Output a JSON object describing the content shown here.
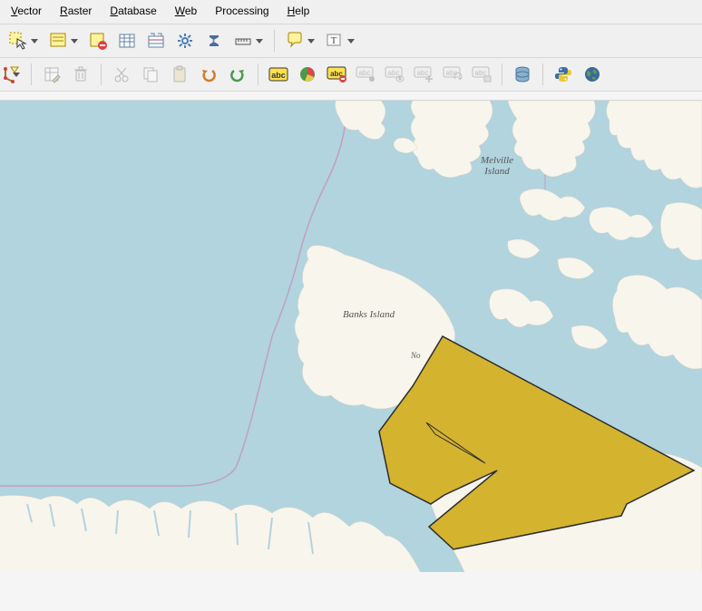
{
  "menu": {
    "vector": {
      "label": "Vector",
      "accel": "V"
    },
    "raster": {
      "label": "Raster",
      "accel": "R"
    },
    "database": {
      "label": "Database",
      "accel": "D"
    },
    "web": {
      "label": "Web",
      "accel": "W"
    },
    "processing": {
      "label": "Processing",
      "accel": ""
    },
    "help": {
      "label": "Help",
      "accel": "H"
    }
  },
  "map": {
    "sea_color": "#b1d4de",
    "land_color": "#f8f5ed",
    "border_color": "#c39ec3",
    "polygon_fill": "#d4b32f",
    "polygon_stroke": "#2b2b2b",
    "labels": {
      "banks": "Banks Island",
      "melville1": "Melville",
      "melville2": "Island",
      "no_partial": "No"
    }
  },
  "toolbar": {
    "row1": [
      {
        "name": "select-features-icon",
        "dd": true
      },
      {
        "name": "select-by-form-icon",
        "dd": true
      },
      {
        "name": "deselect-icon"
      },
      {
        "name": "attribute-table-icon"
      },
      {
        "name": "field-calculator-icon"
      },
      {
        "name": "processing-toolbox-icon"
      },
      {
        "name": "statistics-icon"
      },
      {
        "name": "measure-icon",
        "dd": true
      },
      {
        "name": "sep"
      },
      {
        "name": "map-tips-icon",
        "dd": true
      },
      {
        "name": "text-annotation-icon",
        "dd": true
      }
    ],
    "row2": [
      {
        "name": "vertex-tool-icon",
        "dd": true,
        "cropped": true
      },
      {
        "name": "modify-attributes-icon",
        "disabled": true
      },
      {
        "name": "delete-icon",
        "disabled": true
      },
      {
        "name": "cut-icon",
        "disabled": true
      },
      {
        "name": "copy-icon",
        "disabled": true
      },
      {
        "name": "paste-icon",
        "disabled": true
      },
      {
        "name": "undo-icon"
      },
      {
        "name": "redo-icon"
      },
      {
        "name": "sep"
      },
      {
        "name": "single-label-icon"
      },
      {
        "name": "diagram-icon"
      },
      {
        "name": "label-highlight-icon"
      },
      {
        "name": "label-pin-icon",
        "disabled": true
      },
      {
        "name": "show-hide-label-icon",
        "disabled": true
      },
      {
        "name": "move-label-icon",
        "disabled": true
      },
      {
        "name": "rotate-label-icon",
        "disabled": true
      },
      {
        "name": "change-label-icon",
        "disabled": true
      },
      {
        "name": "sep"
      },
      {
        "name": "database-icon"
      },
      {
        "name": "sep"
      },
      {
        "name": "python-console-icon"
      },
      {
        "name": "wms-browser-icon"
      }
    ]
  }
}
